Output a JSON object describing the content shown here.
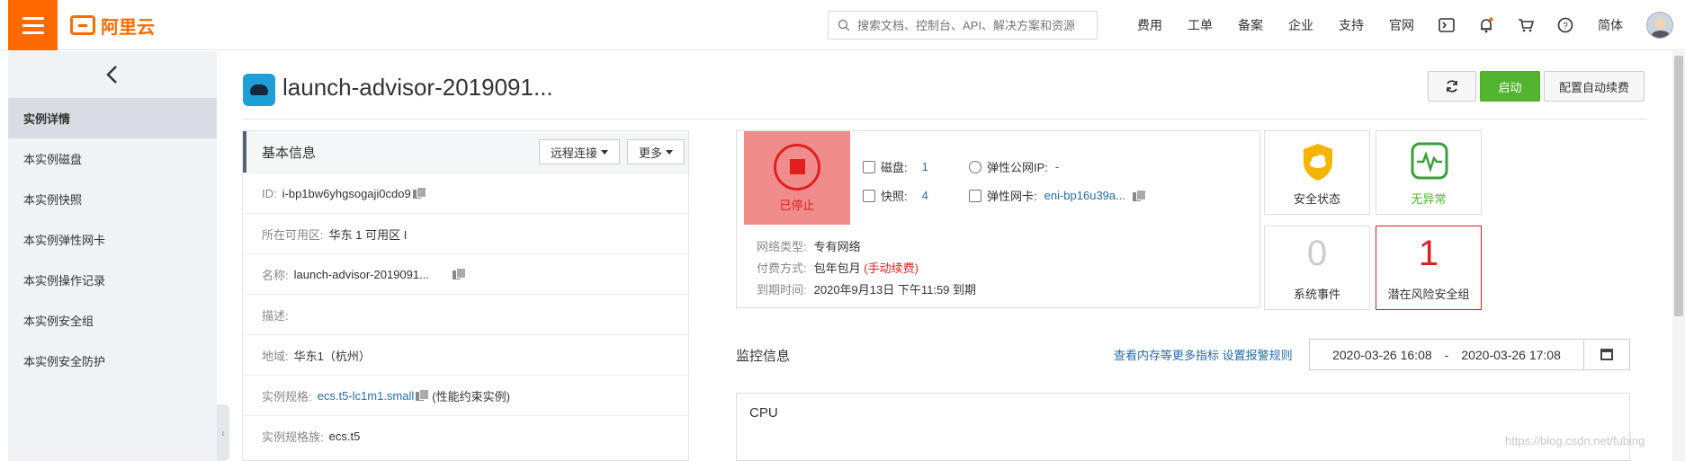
{
  "header": {
    "brand": "阿里云",
    "search_placeholder": "搜索文档、控制台、API、解决方案和资源",
    "nav": [
      "费用",
      "工单",
      "备案",
      "企业",
      "支持",
      "官网"
    ],
    "lang": "简体"
  },
  "sidebar": {
    "items": [
      {
        "label": "实例详情",
        "active": true
      },
      {
        "label": "本实例磁盘"
      },
      {
        "label": "本实例快照"
      },
      {
        "label": "本实例弹性网卡"
      },
      {
        "label": "本实例操作记录"
      },
      {
        "label": "本实例安全组"
      },
      {
        "label": "本实例安全防护"
      }
    ]
  },
  "page": {
    "title": "launch-advisor-2019091...",
    "buttons": {
      "start": "启动",
      "auto_renew": "配置自动续费"
    }
  },
  "basic_info": {
    "title": "基本信息",
    "remote_btn": "远程连接",
    "more_btn": "更多",
    "rows": [
      {
        "key": "ID:",
        "value": "i-bp1bw6yhgsogaji0cdo9"
      },
      {
        "key": "所在可用区:",
        "value": "华东 1 可用区 I"
      },
      {
        "key": "名称:",
        "value": "launch-advisor-2019091..."
      },
      {
        "key": "描述:",
        "value": ""
      },
      {
        "key": "地域:",
        "value": "华东1（杭州）"
      },
      {
        "key": "实例规格:",
        "value": "ecs.t5-lc1m1.small",
        "suffix": "(性能约束实例)"
      },
      {
        "key": "实例规格族:",
        "value": "ecs.t5"
      }
    ]
  },
  "status": {
    "state": "已停止",
    "disk_label": "磁盘:",
    "disk_count": "1",
    "snapshot_label": "快照:",
    "snapshot_count": "4",
    "eip_label": "弹性公网IP:",
    "eip_value": "-",
    "eni_label": "弹性网卡:",
    "eni_value": "eni-bp16u39a...",
    "network_type_key": "网络类型:",
    "network_type": "专有网络",
    "billing_key": "付费方式:",
    "billing": "包年包月",
    "billing_note": "(手动续费)",
    "expire_key": "到期时间:",
    "expire": "2020年9月13日 下午11:59 到期"
  },
  "cards": {
    "security_state": "安全状态",
    "no_anomaly": "无异常",
    "system_events_count": "0",
    "system_events": "系统事件",
    "risk_count": "1",
    "risk_label": "潜在风险安全组"
  },
  "monitor": {
    "title": "监控信息",
    "links": "查看内存等更多指标 设置报警规则",
    "date_from": "2020-03-26 16:08",
    "date_sep": "-",
    "date_to": "2020-03-26 17:08",
    "cpu_label": "CPU"
  },
  "watermark": "https://blog.csdn.net/fubing",
  "colors": {
    "brand": "#ff6a00",
    "start": "#52b42f",
    "danger": "#e02020",
    "link": "#1f6fb5"
  }
}
